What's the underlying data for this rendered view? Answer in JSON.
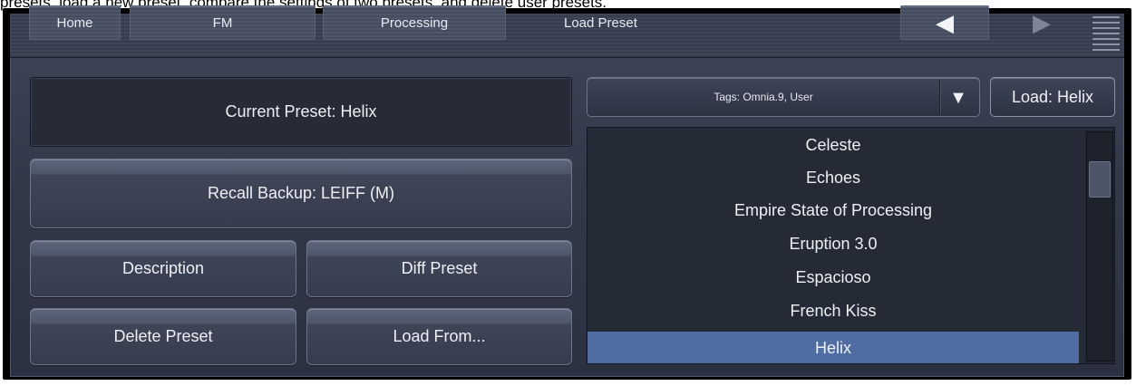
{
  "caption": "presets, load a new preset, compare the settings of two presets, and delete user presets.",
  "nav": {
    "tabs": [
      "Home",
      "FM",
      "Processing"
    ],
    "current": "Load Preset",
    "back_icon": "◀",
    "forward_icon": "▶"
  },
  "current_preset": "Current Preset: Helix",
  "buttons": {
    "recall_backup": "Recall Backup: LEIFF (M)",
    "description": "Description",
    "diff_preset": "Diff Preset",
    "delete_preset": "Delete Preset",
    "load_from": "Load From..."
  },
  "tags": {
    "value": "Tags: Omnia.9, User",
    "caret": "▼"
  },
  "load_button": "Load: Helix",
  "preset_list": {
    "items": [
      "Celeste",
      "Echoes",
      "Empire State of Processing",
      "Eruption 3.0",
      "Espacioso",
      "French Kiss",
      "Helix"
    ],
    "selected_index": 6
  },
  "colors": {
    "selected": "#4f6da2",
    "panel": "#323949"
  }
}
